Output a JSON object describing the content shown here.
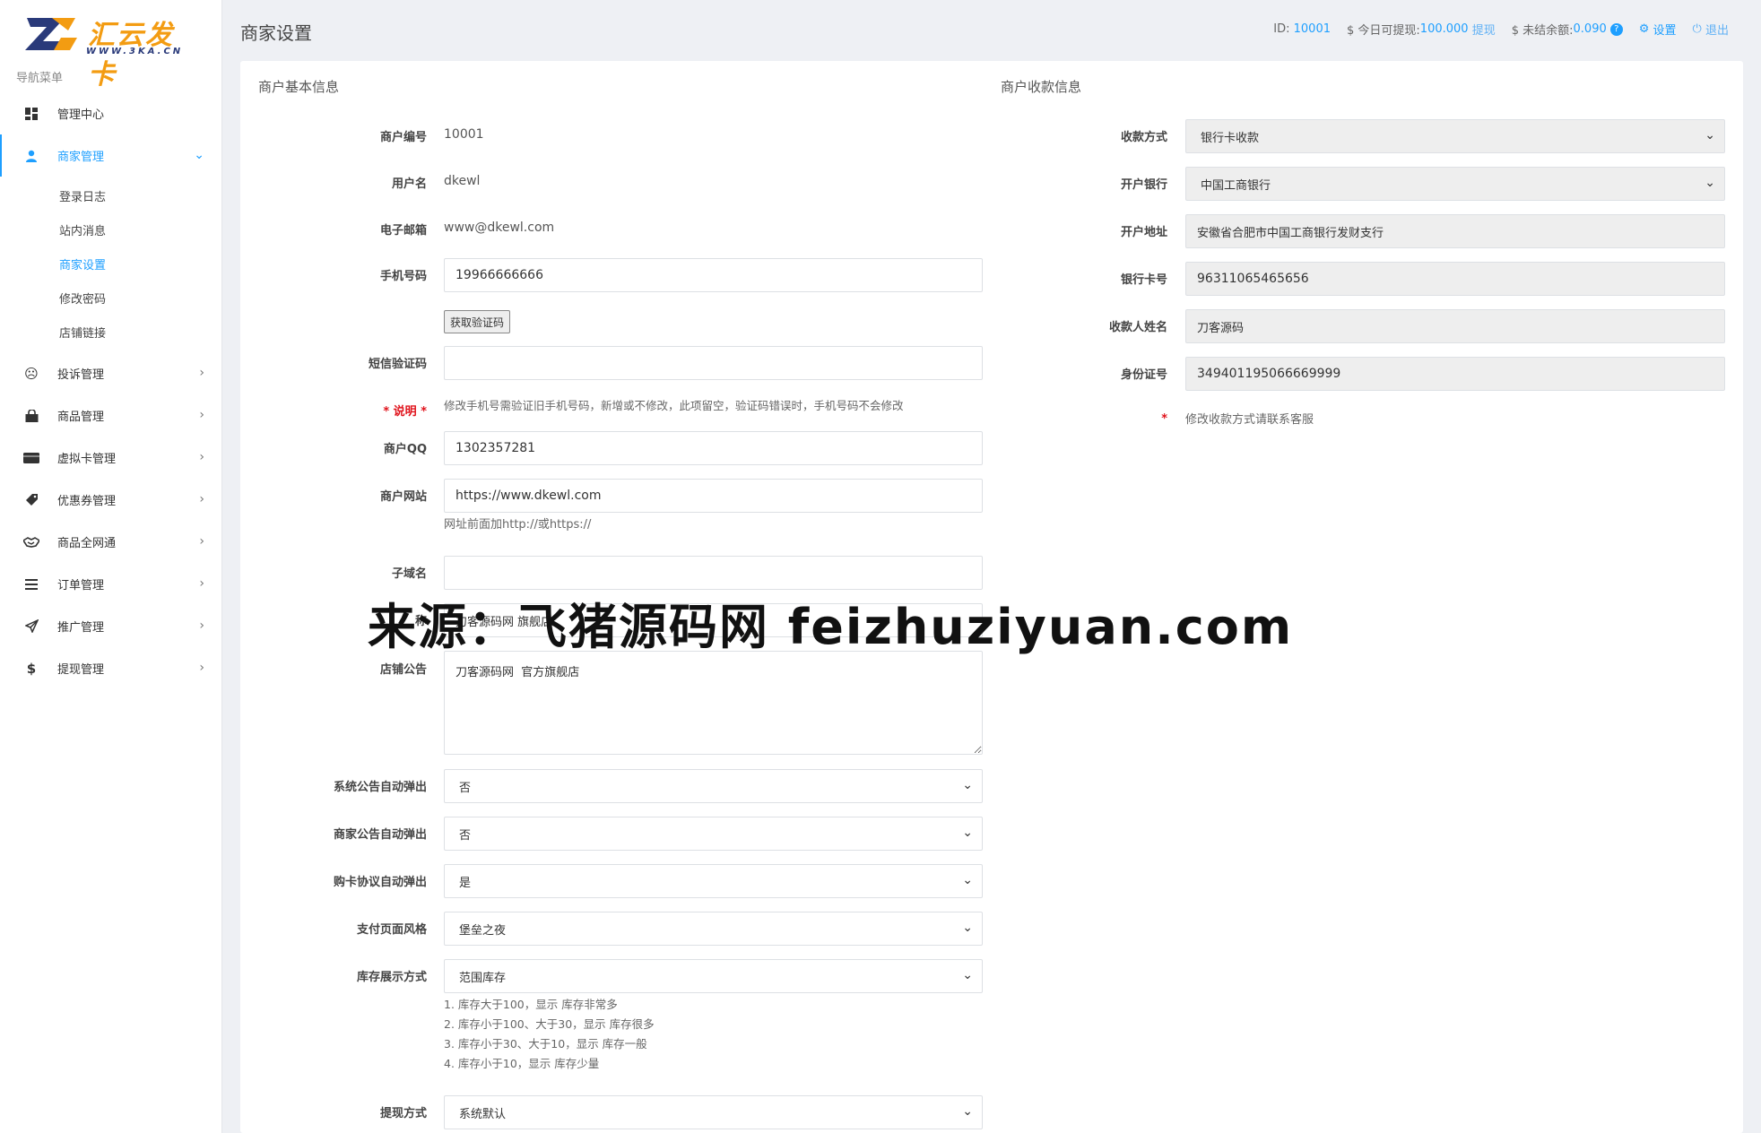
{
  "logo": {
    "title": "汇云发卡",
    "sub": "WWW.3KA.CN"
  },
  "sidebar": {
    "caption": "导航菜单",
    "items": [
      {
        "label": "管理中心",
        "icon": "dashboard-icon"
      },
      {
        "label": "商家管理",
        "icon": "user-icon",
        "open": true,
        "children": [
          "登录日志",
          "站内消息",
          "商家设置",
          "修改密码",
          "店铺链接"
        ],
        "active_child": 2
      },
      {
        "label": "投诉管理",
        "icon": "frown-icon"
      },
      {
        "label": "商品管理",
        "icon": "shopping-bag-icon"
      },
      {
        "label": "虚拟卡管理",
        "icon": "credit-card-icon"
      },
      {
        "label": "优惠券管理",
        "icon": "coupon-icon"
      },
      {
        "label": "商品全网通",
        "icon": "handshake-icon"
      },
      {
        "label": "订单管理",
        "icon": "list-icon"
      },
      {
        "label": "推广管理",
        "icon": "send-icon"
      },
      {
        "label": "提现管理",
        "icon": "dollar-icon"
      }
    ]
  },
  "header": {
    "title": "商家设置",
    "id_label": "ID:",
    "id_value": "10001",
    "withdrawable_label": "$ 今日可提现:",
    "withdrawable_value": "100.000",
    "withdraw_link": "提现",
    "unsettled_label": "$ 未结余额:",
    "unsettled_value": "0.090",
    "help": "?",
    "settings": "设置",
    "logout": "退出"
  },
  "basic": {
    "title": "商户基本信息",
    "merchant_no_label": "商户编号",
    "merchant_no": "10001",
    "username_label": "用户名",
    "username": "dkewl",
    "email_label": "电子邮箱",
    "email": "www@dkewl.com",
    "phone_label": "手机号码",
    "phone": "19966666666",
    "get_code": "获取验证码",
    "sms_label": "短信验证码",
    "sms": "",
    "note_label": "* 说明 *",
    "note_text": "修改手机号需验证旧手机号码，新增或不修改，此项留空，验证码错误时，手机号码不会修改",
    "qq_label": "商户QQ",
    "qq": "1302357281",
    "site_label": "商户网站",
    "site": "https://www.dkewl.com",
    "site_hint": "网址前面加http://或https://",
    "subdomain_label": "子域名",
    "subdomain": "",
    "shopname_label": "称",
    "shopname": "刀客源码网 旗舰店",
    "notice_label": "店铺公告",
    "notice": "刀客源码网  官方旗舰店",
    "sys_popup_label": "系统公告自动弹出",
    "sys_popup": "否",
    "shop_popup_label": "商家公告自动弹出",
    "shop_popup": "否",
    "agree_popup_label": "购卡协议自动弹出",
    "agree_popup": "是",
    "pay_style_label": "支付页面风格",
    "pay_style": "堡垒之夜",
    "stock_label": "库存展示方式",
    "stock": "范围库存",
    "stock_hints": [
      "1. 库存大于100，显示 库存非常多",
      "2. 库存小于100、大于30，显示 库存很多",
      "3. 库存小于30、大于10，显示 库存一般",
      "4. 库存小于10，显示 库存少量"
    ],
    "withdraw_label": "提现方式",
    "withdraw": "系统默认"
  },
  "payment": {
    "title": "商户收款信息",
    "method_label": "收款方式",
    "method": "银行卡收款",
    "bank_label": "开户银行",
    "bank": "中国工商银行",
    "address_label": "开户地址",
    "address": "安徽省合肥市中国工商银行发财支行",
    "card_label": "银行卡号",
    "card": "96311065465656",
    "name_label": "收款人姓名",
    "name": "刀客源码",
    "idno_label": "身份证号",
    "idno": "349401195066669999",
    "note_star": "*",
    "note": "修改收款方式请联系客服"
  },
  "watermark": "来源：飞猪源码网 feizhuziyuan.com",
  "colors": {
    "accent": "#1e9fff",
    "danger": "#e0121b",
    "logo_orange": "#f39c12"
  }
}
